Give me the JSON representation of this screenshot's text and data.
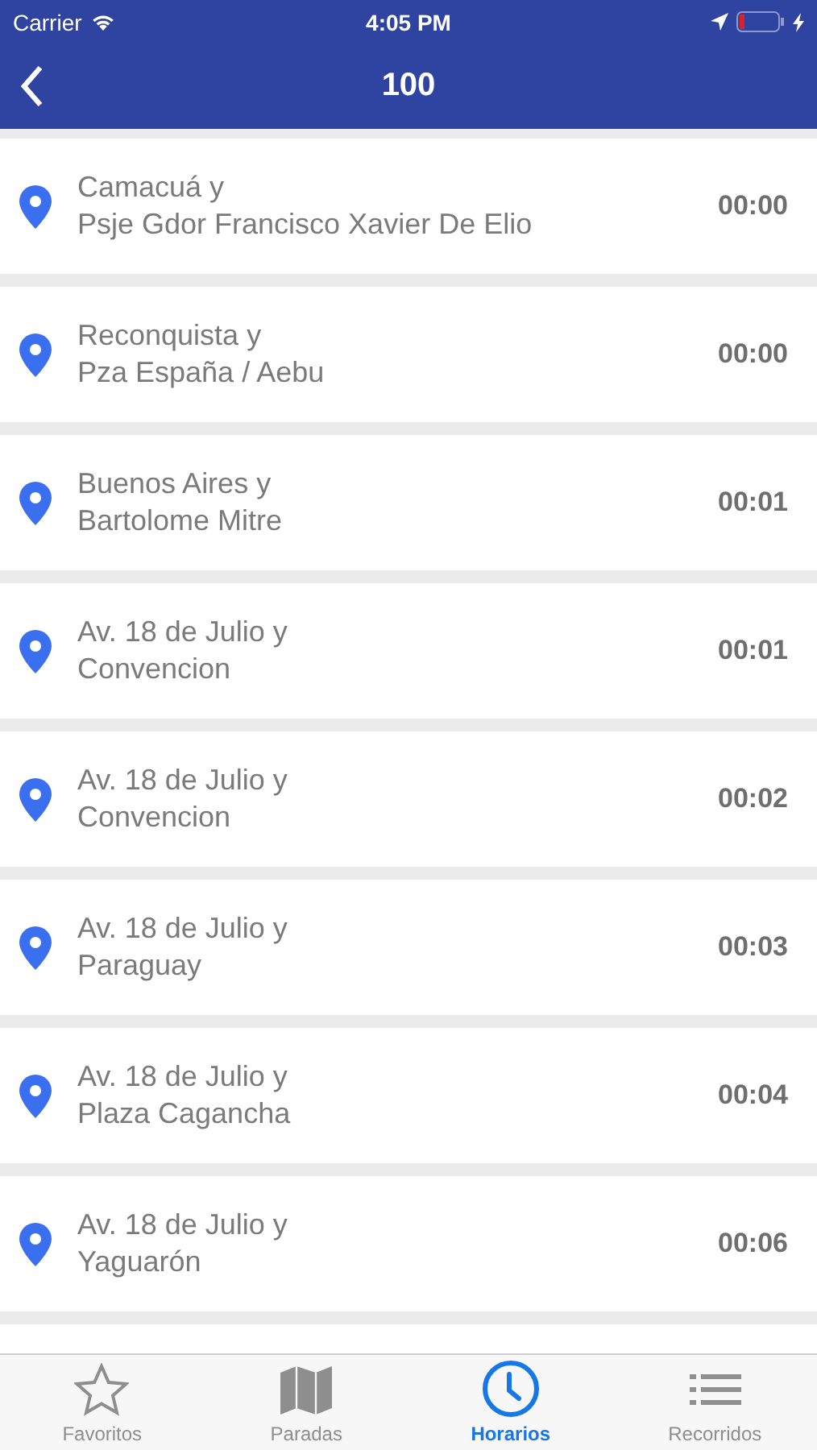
{
  "status_bar": {
    "carrier": "Carrier",
    "time": "4:05 PM",
    "battery_charging": true
  },
  "nav": {
    "title": "100"
  },
  "stops": [
    {
      "line1": "Camacuá y",
      "line2": "Psje Gdor Francisco Xavier De Elio",
      "time": "00:00"
    },
    {
      "line1": "Reconquista y",
      "line2": "Pza España / Aebu",
      "time": "00:00"
    },
    {
      "line1": "Buenos Aires y",
      "line2": "Bartolome Mitre",
      "time": "00:01"
    },
    {
      "line1": "Av. 18 de Julio y",
      "line2": "Convencion",
      "time": "00:01"
    },
    {
      "line1": "Av. 18 de Julio y",
      "line2": "Convencion",
      "time": "00:02"
    },
    {
      "line1": "Av. 18 de Julio y",
      "line2": "Paraguay",
      "time": "00:03"
    },
    {
      "line1": "Av. 18 de Julio y",
      "line2": "Plaza Cagancha",
      "time": "00:04"
    },
    {
      "line1": "Av. 18 de Julio y",
      "line2": "Yaguarón",
      "time": "00:06"
    }
  ],
  "tabs": [
    {
      "kind": "star",
      "label": "Favoritos",
      "selected": false
    },
    {
      "kind": "map",
      "label": "Paradas",
      "selected": false
    },
    {
      "kind": "clock",
      "label": "Horarios",
      "selected": true
    },
    {
      "kind": "list",
      "label": "Recorridos",
      "selected": false
    }
  ]
}
